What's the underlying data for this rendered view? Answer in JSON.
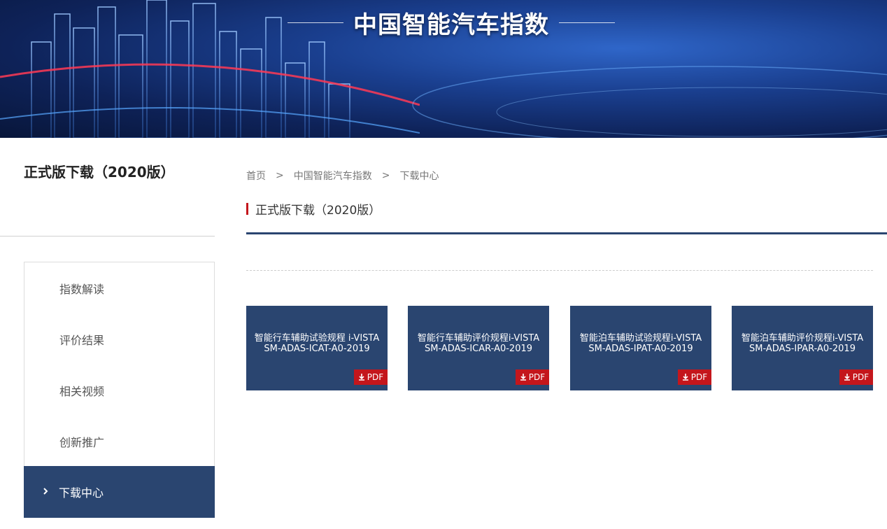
{
  "banner": {
    "title": "中国智能汽车指数"
  },
  "sidebar": {
    "heading": "正式版下载（2020版）",
    "items": [
      {
        "label": "指数解读"
      },
      {
        "label": "评价结果"
      },
      {
        "label": "相关视频"
      },
      {
        "label": "创新推广"
      },
      {
        "label": "下载中心",
        "active": true
      }
    ]
  },
  "breadcrumb": {
    "items": [
      "首页",
      "中国智能汽车指数",
      "下载中心"
    ],
    "separator": ">"
  },
  "section": {
    "title": "正式版下载（2020版）"
  },
  "documents": [
    {
      "line1": "智能行车辅助试验规程 i-VISTA",
      "line2": "SM-ADAS-ICAT-A0-2019",
      "badge": "PDF"
    },
    {
      "line1": "智能行车辅助评价规程i-VISTA",
      "line2": "SM-ADAS-ICAR-A0-2019",
      "badge": "PDF"
    },
    {
      "line1": "智能泊车辅助试验规程i-VISTA",
      "line2": "SM-ADAS-IPAT-A0-2019",
      "badge": "PDF"
    },
    {
      "line1": "智能泊车辅助评价规程i-VISTA",
      "line2": "SM-ADAS-IPAR-A0-2019",
      "badge": "PDF"
    }
  ],
  "colors": {
    "navy": "#2a4570",
    "red": "#c4161c"
  }
}
